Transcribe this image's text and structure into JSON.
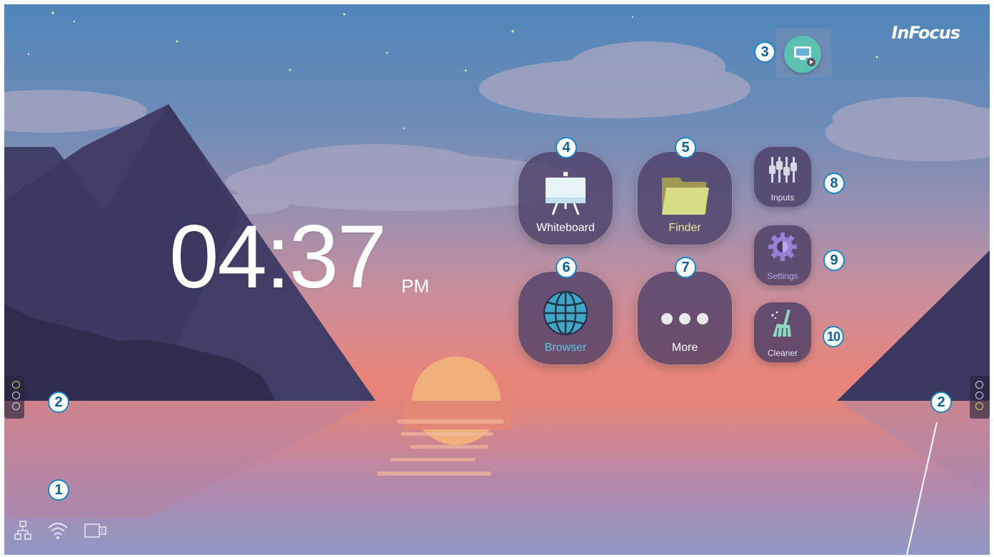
{
  "brand": {
    "logo_text": "InFocus"
  },
  "clock": {
    "time": "04:37",
    "ampm": "PM"
  },
  "apps": [
    {
      "label": "Whiteboard",
      "badge": "4",
      "icon": "whiteboard-icon"
    },
    {
      "label": "Finder",
      "badge": "5",
      "icon": "folder-icon"
    },
    {
      "label": "Browser",
      "badge": "6",
      "icon": "globe-icon"
    },
    {
      "label": "More",
      "badge": "7",
      "icon": "more-dots-icon"
    }
  ],
  "quick": [
    {
      "label": "Inputs",
      "badge": "8",
      "icon": "inputs-icon"
    },
    {
      "label": "Settings",
      "badge": "9",
      "icon": "gear-icon"
    },
    {
      "label": "Cleaner",
      "badge": "10",
      "icon": "broom-icon"
    }
  ],
  "badges": {
    "status_bar": "1",
    "side_toolbar_left": "2",
    "side_toolbar_right": "2",
    "cast": "3"
  },
  "status_icons": [
    "network-icon",
    "wifi-icon",
    "usb-drive-icon"
  ],
  "colors": {
    "accent_blue": "#1b86c4",
    "tile_bg": "#4a3e65",
    "folder_yellow": "#d6dd86",
    "browser_teal": "#3fa6c7"
  }
}
